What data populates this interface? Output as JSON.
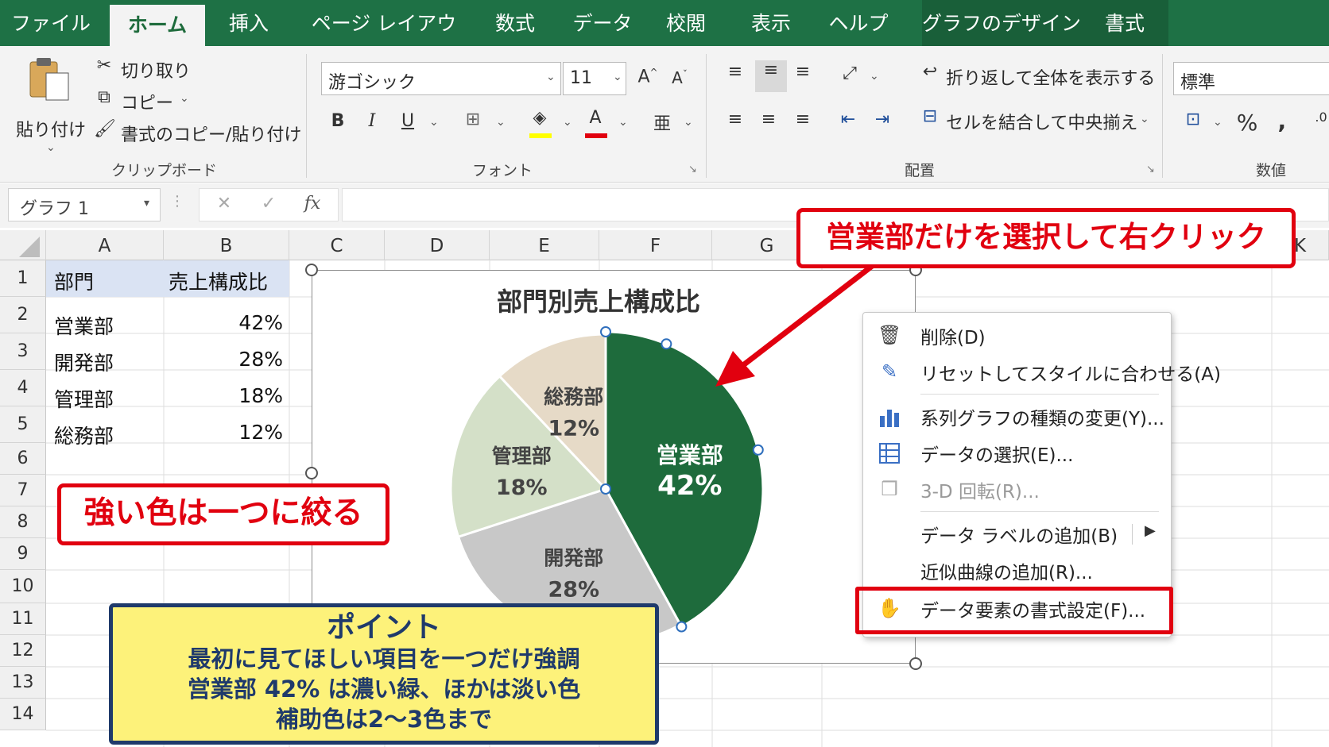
{
  "tabs": [
    {
      "label": "ファイル"
    },
    {
      "label": "ホーム"
    },
    {
      "label": "挿入"
    },
    {
      "label": "ページ レイアウト"
    },
    {
      "label": "数式"
    },
    {
      "label": "データ"
    },
    {
      "label": "校閲"
    },
    {
      "label": "表示"
    },
    {
      "label": "ヘルプ"
    },
    {
      "label": "グラフのデザイン"
    },
    {
      "label": "書式"
    }
  ],
  "ribbon": {
    "clipboard": {
      "paste": "貼り付け",
      "cut": "切り取り",
      "copy": "コピー",
      "format_painter": "書式のコピー/貼り付け",
      "group_label": "クリップボード"
    },
    "font": {
      "font_name": "游ゴシック",
      "font_size": "11",
      "bold": "B",
      "italic": "I",
      "underline": "U",
      "group_label": "フォント"
    },
    "alignment": {
      "wrap_text": "折り返して全体を表示する",
      "merge_center": "セルを結合して中央揃え",
      "group_label": "配置"
    },
    "number": {
      "format": "標準",
      "percent": "%",
      "comma": " ,",
      "group_label": "数値"
    }
  },
  "formula_bar": {
    "name_box": "グラフ 1",
    "fx": "fx"
  },
  "columns": [
    "A",
    "B",
    "C",
    "D",
    "E",
    "F",
    "G",
    "K"
  ],
  "rows": [
    "1",
    "2",
    "3",
    "4",
    "5",
    "6",
    "7",
    "8",
    "9",
    "10",
    "11",
    "12",
    "13",
    "14"
  ],
  "table": {
    "headers": [
      "部門",
      "売上構成比"
    ],
    "rows": [
      [
        "営業部",
        "42%"
      ],
      [
        "開発部",
        "28%"
      ],
      [
        "管理部",
        "18%"
      ],
      [
        "総務部",
        "12%"
      ]
    ]
  },
  "chart_data": {
    "type": "pie",
    "title": "部門別売上構成比",
    "categories": [
      "営業部",
      "開発部",
      "管理部",
      "総務部"
    ],
    "values": [
      42,
      28,
      18,
      12
    ],
    "labels": [
      "42%",
      "28%",
      "18%",
      "12%"
    ],
    "colors": [
      "#1e6b3c",
      "#c8c8c8",
      "#d4e0c8",
      "#e6dac7"
    ],
    "highlighted": "営業部"
  },
  "context_menu": {
    "items": [
      {
        "icon": "trash-icon",
        "label": "削除(D)",
        "enabled": true
      },
      {
        "icon": "reset-style-icon",
        "label": "リセットしてスタイルに合わせる(A)",
        "enabled": true
      },
      {
        "icon": "chart-type-icon",
        "label": "系列グラフの種類の変更(Y)...",
        "enabled": true
      },
      {
        "icon": "select-data-icon",
        "label": "データの選択(E)...",
        "enabled": true
      },
      {
        "icon": "rotate-3d-icon",
        "label": "3-D 回転(R)...",
        "enabled": false
      },
      {
        "icon": "",
        "label": "データ ラベルの追加(B)",
        "enabled": true,
        "submenu": true
      },
      {
        "icon": "",
        "label": "近似曲線の追加(R)...",
        "enabled": true
      },
      {
        "icon": "format-point-icon",
        "label": "データ要素の書式設定(F)...",
        "enabled": true,
        "highlighted": true
      }
    ]
  },
  "callouts": {
    "top": "営業部だけを選択して右クリック",
    "left": "強い色は一つに絞る"
  },
  "point_box": {
    "title": "ポイント",
    "lines": [
      "最初に見てほしい項目を一つだけ強調",
      "営業部 42% は濃い緑、ほかは淡い色",
      "補助色は2〜3色まで"
    ]
  },
  "colors": {
    "excel_green": "#1e7145",
    "highlight_red": "#e1000f",
    "point_bg": "#fdf27a",
    "point_border": "#1f3a6b"
  }
}
